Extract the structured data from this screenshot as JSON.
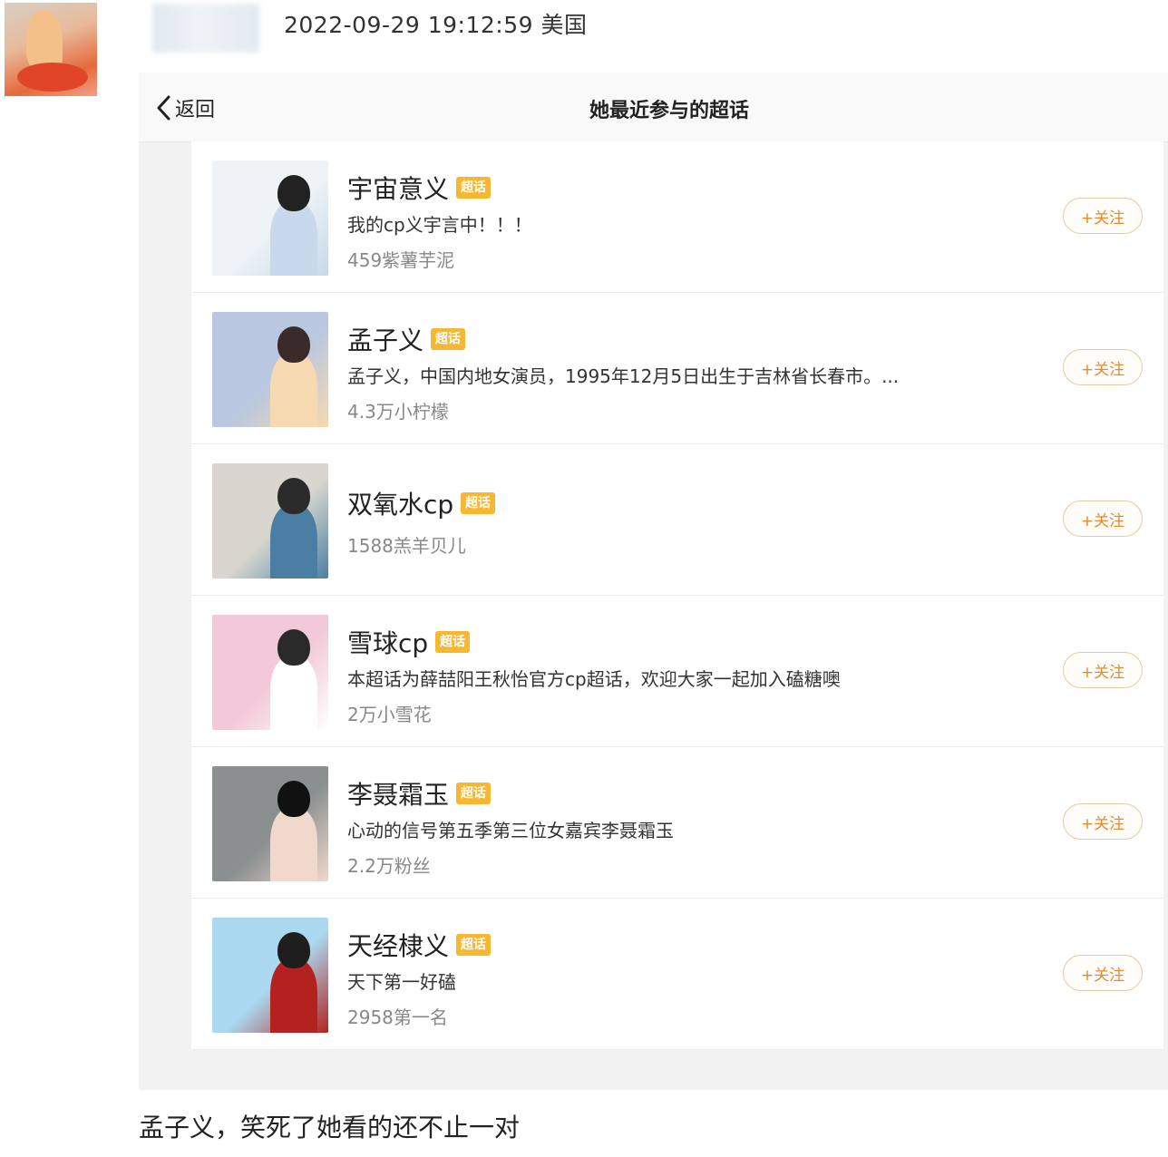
{
  "post": {
    "timestamp": "2022-09-29 19:12:59 美国",
    "caption": "孟子义，笑死了她看的还不止一对"
  },
  "screenshot": {
    "nav": {
      "back_label": "返回",
      "title": "她最近参与的超话"
    },
    "follow_label": "+关注",
    "badge_label": "超话",
    "topics": [
      {
        "title": "宇宙意义",
        "desc": "我的cp义宇言中！！！",
        "stat": "459紫薯芋泥",
        "thumb_colors": [
          "#eef3f6",
          "#c7d9ea",
          "#222222"
        ]
      },
      {
        "title": "孟子义",
        "desc": "孟子义，中国内地女演员，1995年12月5日出生于吉林省长春市。...",
        "stat": "4.3万小柠檬",
        "thumb_colors": [
          "#b9c7e0",
          "#f6d9b0",
          "#3a2a2a"
        ]
      },
      {
        "title": "双氧水cp",
        "desc": "",
        "stat": "1588羔羊贝儿",
        "thumb_colors": [
          "#d8d6cf",
          "#4a7fa3",
          "#2b2b2b"
        ]
      },
      {
        "title": "雪球cp",
        "desc": "本超话为薛喆阳王秋怡官方cp超话，欢迎大家一起加入磕糖噢",
        "stat": "2万小雪花",
        "thumb_colors": [
          "#f2c9d8",
          "#ffffff",
          "#2a2a2a"
        ]
      },
      {
        "title": "李聂霜玉",
        "desc": "心动的信号第五季第三位女嘉宾李聂霜玉",
        "stat": "2.2万粉丝",
        "thumb_colors": [
          "#8a8f8f",
          "#f0d9cc",
          "#111111"
        ]
      },
      {
        "title": "天经棣义",
        "desc": "天下第一好磕",
        "stat": "2958第一名",
        "thumb_colors": [
          "#a9d8ef",
          "#b3221f",
          "#1e1e1e"
        ]
      }
    ]
  }
}
